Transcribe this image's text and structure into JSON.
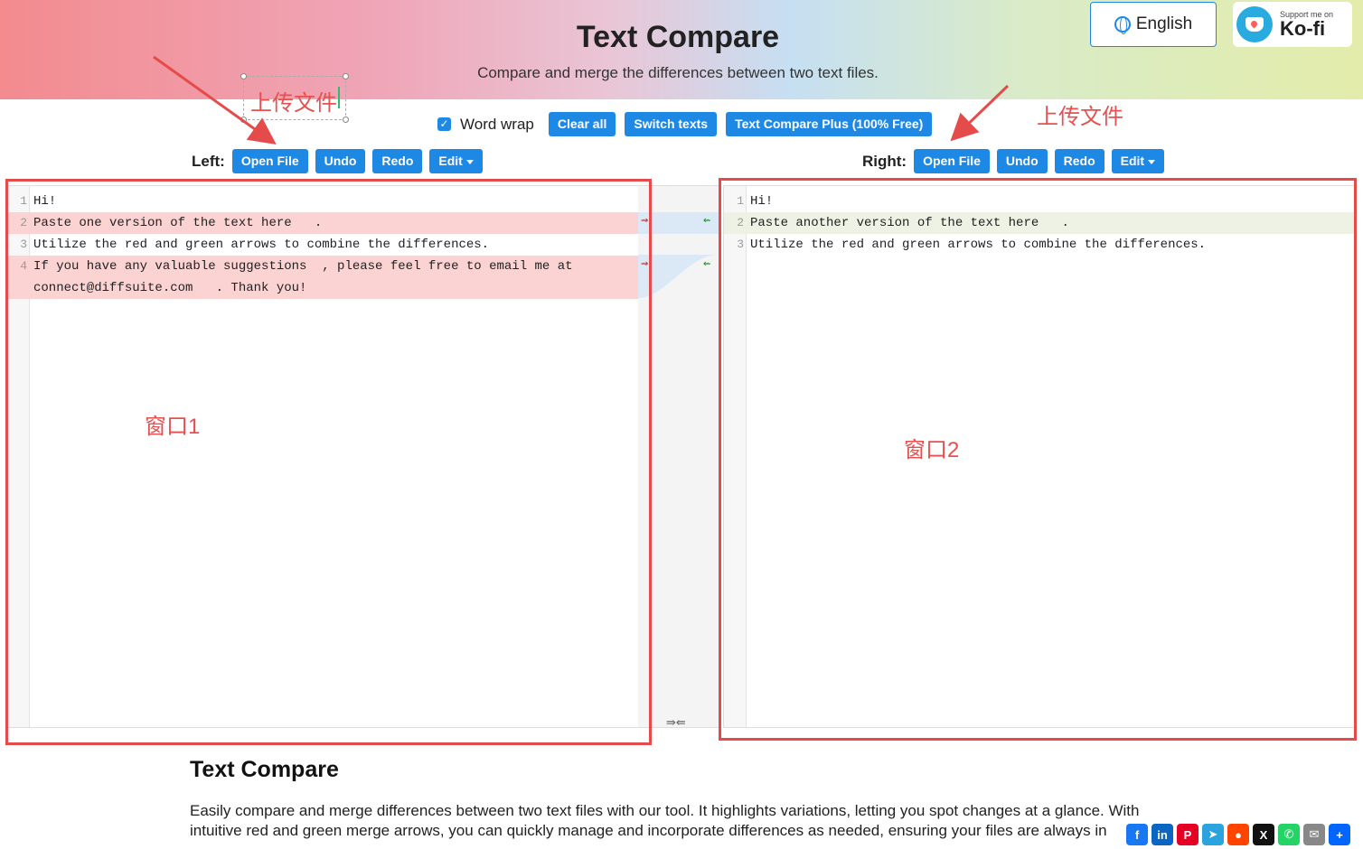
{
  "header": {
    "title": "Text Compare",
    "subtitle": "Compare and merge the differences between two text files.",
    "language_button": "English",
    "kofi_small": "Support me on",
    "kofi_big": "Ko-fi"
  },
  "toolbar": {
    "word_wrap_label": "Word wrap",
    "word_wrap_checked": true,
    "clear_all": "Clear all",
    "switch_texts": "Switch texts",
    "plus": "Text Compare Plus (100% Free)"
  },
  "left": {
    "label": "Left:",
    "open_file": "Open File",
    "undo": "Undo",
    "redo": "Redo",
    "edit": "Edit",
    "lines": [
      {
        "num": "1",
        "text": "Hi!",
        "state": "normal"
      },
      {
        "num": "2",
        "text": "Paste one version of the text here   .",
        "state": "removed"
      },
      {
        "num": "3",
        "text": "Utilize the red and green arrows to combine the differences.",
        "state": "normal"
      },
      {
        "num": "4",
        "text": "If you have any valuable suggestions  , please feel free to email me at",
        "state": "removed"
      },
      {
        "num": "",
        "text": "connect@diffsuite.com   . Thank you!",
        "state": "removed"
      }
    ]
  },
  "right": {
    "label": "Right:",
    "open_file": "Open File",
    "undo": "Undo",
    "redo": "Redo",
    "edit": "Edit",
    "lines": [
      {
        "num": "1",
        "text": "Hi!",
        "state": "normal"
      },
      {
        "num": "2",
        "text": "Paste another version of the text here   .",
        "state": "added"
      },
      {
        "num": "3",
        "text": "Utilize the red and green arrows to combine the differences.",
        "state": "normal"
      }
    ]
  },
  "annotations": {
    "upload_left": "上传文件",
    "upload_right": "上传文件",
    "window1": "窗口1",
    "window2": "窗口2",
    "color": "#e64b4b"
  },
  "swap_icon": "⇛⇚",
  "footer": {
    "title": "Text Compare",
    "text": "Easily compare and merge differences between two text files with our tool. It highlights variations, letting you spot changes at a glance. With intuitive red and green merge arrows, you can quickly manage and incorporate differences as needed, ensuring your files are always in"
  },
  "share_icons": [
    {
      "name": "facebook-icon",
      "glyph": "f",
      "color": "#1877f2"
    },
    {
      "name": "linkedin-icon",
      "glyph": "in",
      "color": "#0a66c2"
    },
    {
      "name": "pinterest-icon",
      "glyph": "P",
      "color": "#e60023"
    },
    {
      "name": "telegram-icon",
      "glyph": "➤",
      "color": "#2aa3df"
    },
    {
      "name": "reddit-icon",
      "glyph": "●",
      "color": "#ff4500"
    },
    {
      "name": "x-icon",
      "glyph": "X",
      "color": "#111111"
    },
    {
      "name": "whatsapp-icon",
      "glyph": "✆",
      "color": "#25d366"
    },
    {
      "name": "email-icon",
      "glyph": "✉",
      "color": "#888888"
    },
    {
      "name": "share-more-icon",
      "glyph": "+",
      "color": "#0166ff"
    }
  ]
}
